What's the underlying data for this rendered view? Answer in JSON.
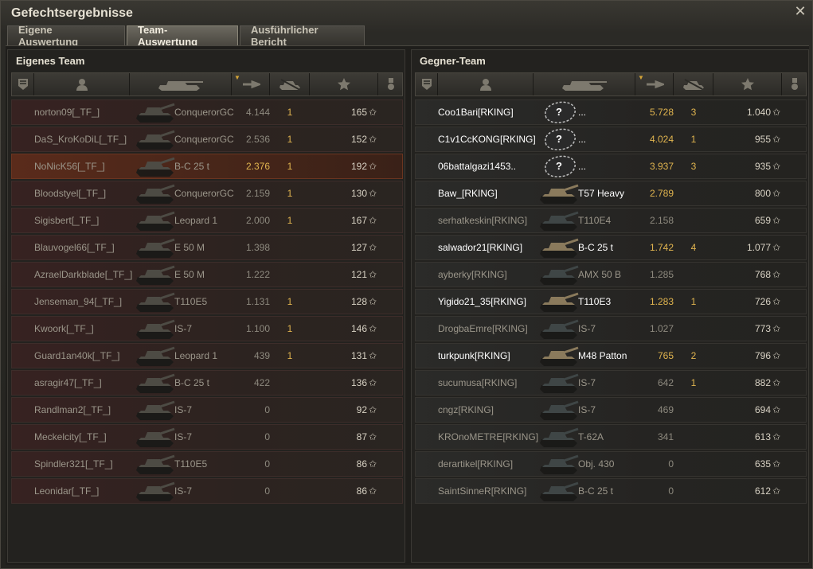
{
  "window": {
    "title": "Gefechtsergebnisse",
    "close_glyph": "✕"
  },
  "tabs": [
    {
      "label": "Eigene Auswertung",
      "active": false
    },
    {
      "label": "Team-Auswertung",
      "active": true
    },
    {
      "label": "Ausführlicher Bericht",
      "active": false
    }
  ],
  "columns": {
    "badge_icon": "badge-icon",
    "player_icon": "player-icon",
    "vehicle_icon": "tank-icon",
    "damage_icon": "damage-icon",
    "kills_icon": "kills-icon",
    "xp_icon": "star-icon",
    "medal_icon": "medal-icon",
    "sort_glyph": "▼"
  },
  "own_team": {
    "title": "Eigenes Team",
    "rows": [
      {
        "player": "norton09[_TF_]",
        "vehicle": "ConquerorGC",
        "damage": "4.144",
        "kills": "1",
        "xp": "165",
        "state": "dead"
      },
      {
        "player": "DaS_KroKoDiL[_TF_]",
        "vehicle": "ConquerorGC",
        "damage": "2.536",
        "kills": "1",
        "xp": "152",
        "state": "dead"
      },
      {
        "player": "NoNicK56[_TF_]",
        "vehicle": "B-C 25 t",
        "damage": "2.376",
        "kills": "1",
        "xp": "192",
        "state": "self"
      },
      {
        "player": "Bloodstyel[_TF_]",
        "vehicle": "ConquerorGC",
        "damage": "2.159",
        "kills": "1",
        "xp": "130",
        "state": "dead"
      },
      {
        "player": "Sigisbert[_TF_]",
        "vehicle": "Leopard 1",
        "damage": "2.000",
        "kills": "1",
        "xp": "167",
        "state": "dead"
      },
      {
        "player": "Blauvogel66[_TF_]",
        "vehicle": "E 50 M",
        "damage": "1.398",
        "kills": "",
        "xp": "127",
        "state": "dead"
      },
      {
        "player": "AzraelDarkblade[_TF_]",
        "vehicle": "E 50 M",
        "damage": "1.222",
        "kills": "",
        "xp": "121",
        "state": "dead"
      },
      {
        "player": "Jenseman_94[_TF_]",
        "vehicle": "T110E5",
        "damage": "1.131",
        "kills": "1",
        "xp": "128",
        "state": "dead"
      },
      {
        "player": "Kwoork[_TF_]",
        "vehicle": "IS-7",
        "damage": "1.100",
        "kills": "1",
        "xp": "146",
        "state": "dead"
      },
      {
        "player": "Guard1an40k[_TF_]",
        "vehicle": "Leopard 1",
        "damage": "439",
        "kills": "1",
        "xp": "131",
        "state": "dead"
      },
      {
        "player": "asragir47[_TF_]",
        "vehicle": "B-C 25 t",
        "damage": "422",
        "kills": "",
        "xp": "136",
        "state": "dead"
      },
      {
        "player": "Randlman2[_TF_]",
        "vehicle": "IS-7",
        "damage": "0",
        "kills": "",
        "xp": "92",
        "state": "dead"
      },
      {
        "player": "Meckelcity[_TF_]",
        "vehicle": "IS-7",
        "damage": "0",
        "kills": "",
        "xp": "87",
        "state": "dead"
      },
      {
        "player": "Spindler321[_TF_]",
        "vehicle": "T110E5",
        "damage": "0",
        "kills": "",
        "xp": "86",
        "state": "dead"
      },
      {
        "player": "Leonidar[_TF_]",
        "vehicle": "IS-7",
        "damage": "0",
        "kills": "",
        "xp": "86",
        "state": "dead"
      }
    ]
  },
  "enemy_team": {
    "title": "Gegner-Team",
    "rows": [
      {
        "player": "Coo1Bari[RKING]",
        "vehicle": "...",
        "damage": "5.728",
        "kills": "3",
        "xp": "1.040",
        "state": "alive",
        "unknown": true
      },
      {
        "player": "C1v1CcKONG[RKING]",
        "vehicle": "...",
        "damage": "4.024",
        "kills": "1",
        "xp": "955",
        "state": "alive",
        "unknown": true
      },
      {
        "player": "06battalgazi1453..",
        "vehicle": "...",
        "damage": "3.937",
        "kills": "3",
        "xp": "935",
        "state": "alive",
        "unknown": true
      },
      {
        "player": "Baw_[RKING]",
        "vehicle": "T57 Heavy",
        "damage": "2.789",
        "kills": "",
        "xp": "800",
        "state": "alive"
      },
      {
        "player": "serhatkeskin[RKING]",
        "vehicle": "T110E4",
        "damage": "2.158",
        "kills": "",
        "xp": "659",
        "state": "dead"
      },
      {
        "player": "salwador21[RKING]",
        "vehicle": "B-C 25 t",
        "damage": "1.742",
        "kills": "4",
        "xp": "1.077",
        "state": "alive"
      },
      {
        "player": "ayberky[RKING]",
        "vehicle": "AMX 50 B",
        "damage": "1.285",
        "kills": "",
        "xp": "768",
        "state": "dead"
      },
      {
        "player": "Yigido21_35[RKING]",
        "vehicle": "T110E3",
        "damage": "1.283",
        "kills": "1",
        "xp": "726",
        "state": "alive"
      },
      {
        "player": "DrogbaEmre[RKING]",
        "vehicle": "IS-7",
        "damage": "1.027",
        "kills": "",
        "xp": "773",
        "state": "dead"
      },
      {
        "player": "turkpunk[RKING]",
        "vehicle": "M48 Patton",
        "damage": "765",
        "kills": "2",
        "xp": "796",
        "state": "alive"
      },
      {
        "player": "sucumusa[RKING]",
        "vehicle": "IS-7",
        "damage": "642",
        "kills": "1",
        "xp": "882",
        "state": "dead"
      },
      {
        "player": "cngz[RKING]",
        "vehicle": "IS-7",
        "damage": "469",
        "kills": "",
        "xp": "694",
        "state": "dead"
      },
      {
        "player": "KROnoMETRE[RKING]",
        "vehicle": "T-62A",
        "damage": "341",
        "kills": "",
        "xp": "613",
        "state": "dead"
      },
      {
        "player": "derartikel[RKING]",
        "vehicle": "Obj. 430",
        "damage": "0",
        "kills": "",
        "xp": "635",
        "state": "dead"
      },
      {
        "player": "SaintSinneR[RKING]",
        "vehicle": "B-C 25 t",
        "damage": "0",
        "kills": "",
        "xp": "612",
        "state": "dead"
      }
    ]
  },
  "xp_star_glyph": "✩",
  "unknown_tank_glyph": "?"
}
